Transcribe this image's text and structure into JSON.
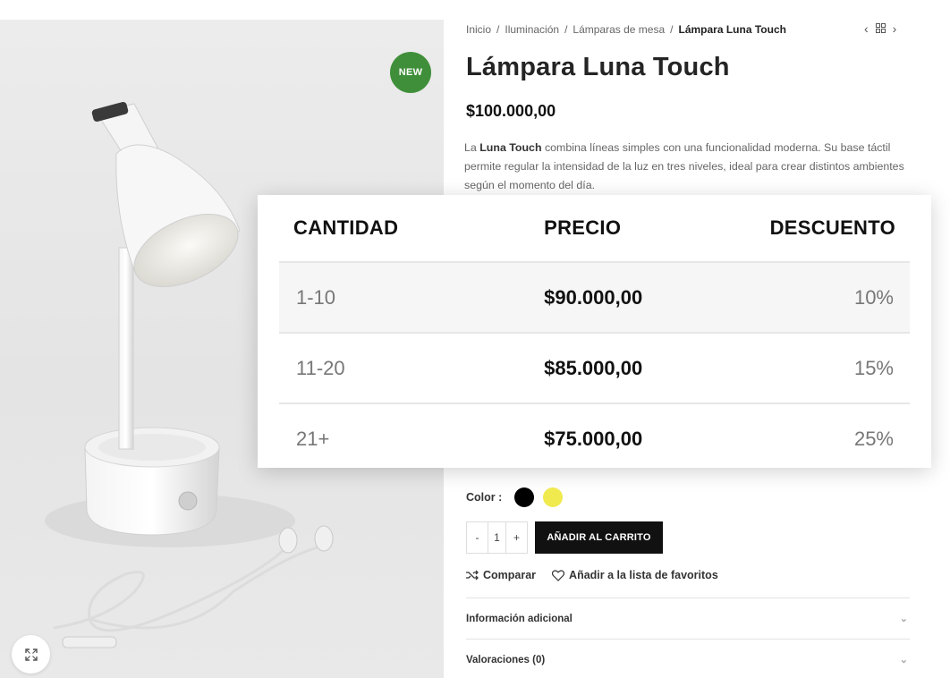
{
  "gallery": {
    "badge": "NEW"
  },
  "breadcrumb": {
    "items": [
      "Inicio",
      "Iluminación",
      "Lámparas de mesa"
    ],
    "current": "Lámpara Luna Touch",
    "separator": "/"
  },
  "product": {
    "title": "Lámpara Luna Touch",
    "price": "$100.000,00",
    "description": {
      "prefix": "La ",
      "bold": "Luna Touch",
      "text": " combina líneas simples con una funcionalidad moderna. Su base táctil permite regular la intensidad de la luz en tres niveles, ideal para crear distintos ambientes según el momento del día."
    }
  },
  "discount_table": {
    "headers": {
      "quantity": "CANTIDAD",
      "price": "PRECIO",
      "discount": "DESCUENTO"
    },
    "rows": [
      {
        "quantity": "1-10",
        "price": "$90.000,00",
        "discount": "10%"
      },
      {
        "quantity": "11-20",
        "price": "$85.000,00",
        "discount": "15%"
      },
      {
        "quantity": "21+",
        "price": "$75.000,00",
        "discount": "25%"
      }
    ]
  },
  "color": {
    "label": "Color :",
    "swatches": [
      "#000000",
      "#f0ea4f"
    ]
  },
  "cart": {
    "minus": "-",
    "quantity": "1",
    "plus": "+",
    "add_label": "AÑADIR AL CARRITO"
  },
  "actions": {
    "compare": "Comparar",
    "wishlist": "Añadir a la lista de favoritos"
  },
  "tabs": [
    {
      "label": "Información adicional"
    },
    {
      "label": "Valoraciones (0)"
    }
  ],
  "colors": {
    "badge_green": "#3f8f3a",
    "button_black": "#111111"
  }
}
